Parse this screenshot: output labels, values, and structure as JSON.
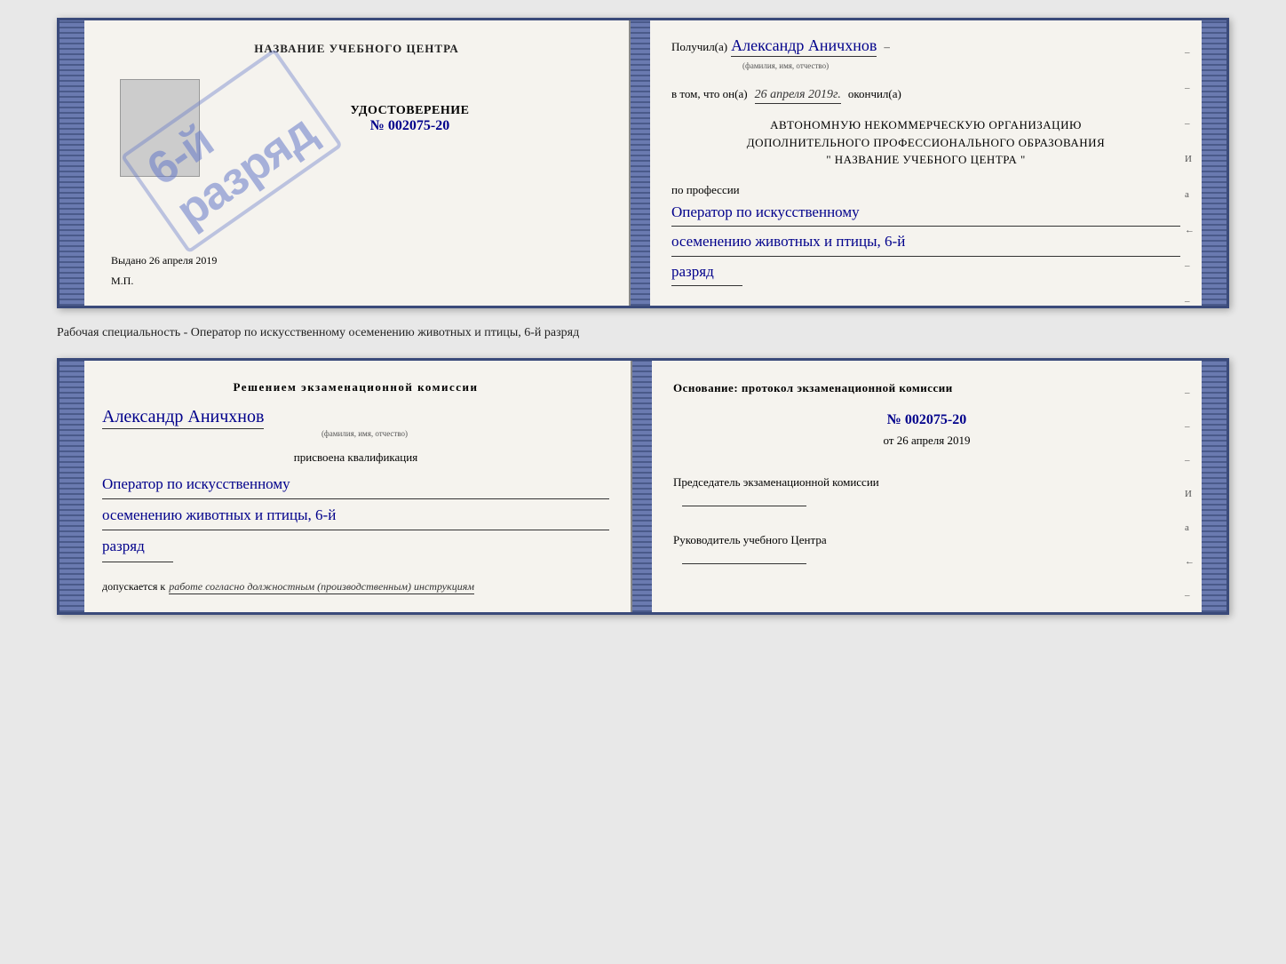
{
  "top_doc": {
    "left": {
      "title": "НАЗВАНИЕ УЧЕБНОГО ЦЕНТРА",
      "cert_label": "УДОСТОВЕРЕНИЕ",
      "cert_number": "№ 002075-20",
      "issued_prefix": "Выдано",
      "issued_date": "26 апреля 2019",
      "mp_label": "М.П.",
      "stamp_text": "6-й\nразряд"
    },
    "right": {
      "received_label": "Получил(а)",
      "person_name": "Александр Аничхнов",
      "name_sublabel": "(фамилия, имя, отчество)",
      "dash": "–",
      "in_that_prefix": "в том, что он(а)",
      "completion_date": "26 апреля 2019г.",
      "finished_label": "окончил(а)",
      "org_line1": "АВТОНОМНУЮ НЕКОММЕРЧЕСКУЮ ОРГАНИЗАЦИЮ",
      "org_line2": "ДОПОЛНИТЕЛЬНОГО ПРОФЕССИОНАЛЬНОГО ОБРАЗОВАНИЯ",
      "org_name": "\" НАЗВАНИЕ УЧЕБНОГО ЦЕНТРА \"",
      "profession_prefix": "по профессии",
      "profession_line1": "Оператор по искусственному",
      "profession_line2": "осеменению животных и птицы, 6-й",
      "profession_line3": "разряд",
      "side_marks": [
        "–",
        "–",
        "–",
        "И",
        "а",
        "←",
        "–",
        "–",
        "–"
      ]
    }
  },
  "description": "Рабочая специальность - Оператор по искусственному осеменению животных и птицы, 6-й разряд",
  "bottom_doc": {
    "left": {
      "decision_title": "Решением экзаменационной комиссии",
      "person_name": "Александр Аничхнов",
      "name_sublabel": "(фамилия, имя, отчество)",
      "qualification_label": "присвоена квалификация",
      "qualification_line1": "Оператор по искусственному",
      "qualification_line2": "осеменению животных и птицы, 6-й",
      "qualification_line3": "разряд",
      "allowed_prefix": "допускается к",
      "allowed_text": "работе согласно должностным (производственным) инструкциям"
    },
    "right": {
      "basis_label": "Основание: протокол экзаменационной комиссии",
      "protocol_number": "№ 002075-20",
      "protocol_date_prefix": "от",
      "protocol_date": "26 апреля 2019",
      "chair_label": "Председатель экзаменационной комиссии",
      "director_label": "Руководитель учебного Центра",
      "side_marks": [
        "–",
        "–",
        "–",
        "И",
        "а",
        "←",
        "–",
        "–",
        "–"
      ]
    }
  }
}
